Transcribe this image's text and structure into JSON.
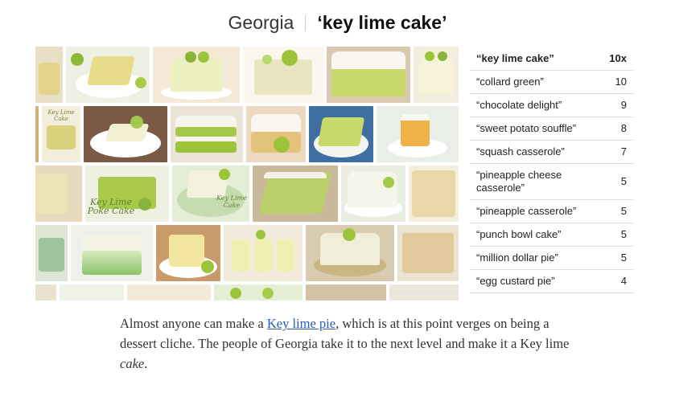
{
  "header": {
    "state": "Georgia",
    "term": "‘key lime cake’"
  },
  "collage": {
    "overlay_texts": [
      "Key Lime Cake",
      "Key Lime Poke Cake",
      "Key Lime Cake",
      "Key Lime Cake"
    ]
  },
  "ranking": [
    {
      "term": "“key lime cake”",
      "count": "10x"
    },
    {
      "term": "“collard green”",
      "count": "10"
    },
    {
      "term": "“chocolate delight”",
      "count": "9"
    },
    {
      "term": "“sweet potato souffle”",
      "count": "8"
    },
    {
      "term": "“squash casserole”",
      "count": "7"
    },
    {
      "term": "“pineapple cheese casserole”",
      "count": "5"
    },
    {
      "term": "“pineapple casserole”",
      "count": "5"
    },
    {
      "term": "“punch bowl cake”",
      "count": "5"
    },
    {
      "term": "“million dollar pie”",
      "count": "5"
    },
    {
      "term": "“egg custard pie”",
      "count": "4"
    }
  ],
  "body": {
    "text_before": "Almost anyone can make a ",
    "link": "Key lime pie",
    "text_after": ", which is at this point verges on being a dessert cliche. The people of Georgia take it to the next level and make it a Key lime ",
    "emphasis": "cake",
    "period": "."
  },
  "colors": {
    "lime": "#9cc43a",
    "cake_green": "#c6d96a",
    "frosting": "#f4f1e4",
    "link": "#2a5db0",
    "divider": "#dddddd"
  }
}
